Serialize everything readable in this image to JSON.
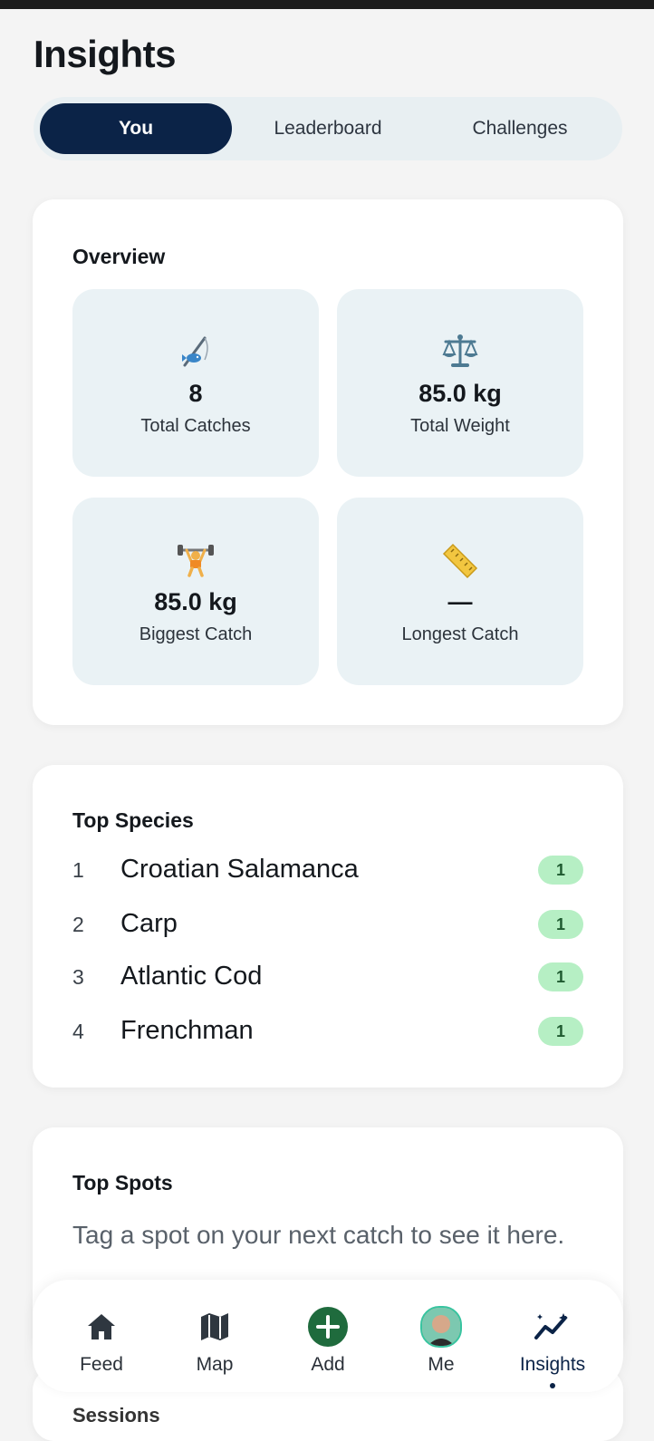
{
  "header": {
    "title": "Insights"
  },
  "tabs": [
    {
      "label": "You",
      "active": true
    },
    {
      "label": "Leaderboard",
      "active": false
    },
    {
      "label": "Challenges",
      "active": false
    }
  ],
  "overview": {
    "title": "Overview",
    "stats": [
      {
        "icon": "fishing-rod-icon",
        "value": "8",
        "label": "Total Catches"
      },
      {
        "icon": "scales-icon",
        "value": "85.0 kg",
        "label": "Total Weight"
      },
      {
        "icon": "weightlifter-icon",
        "value": "85.0 kg",
        "label": "Biggest Catch"
      },
      {
        "icon": "ruler-icon",
        "value": "—",
        "label": "Longest Catch"
      }
    ]
  },
  "top_species": {
    "title": "Top Species",
    "items": [
      {
        "rank": "1",
        "name": "Croatian Salamanca",
        "count": "1"
      },
      {
        "rank": "2",
        "name": "Carp",
        "count": "1"
      },
      {
        "rank": "3",
        "name": "Atlantic Cod",
        "count": "1"
      },
      {
        "rank": "4",
        "name": "Frenchman",
        "count": "1"
      }
    ]
  },
  "top_spots": {
    "title": "Top Spots",
    "empty_text": "Tag a spot on your next catch to see it here."
  },
  "next_section_peek": "Sessions",
  "bottom_nav": [
    {
      "label": "Feed",
      "icon": "home-icon"
    },
    {
      "label": "Map",
      "icon": "map-icon"
    },
    {
      "label": "Add",
      "icon": "add-icon"
    },
    {
      "label": "Me",
      "icon": "avatar"
    },
    {
      "label": "Insights",
      "icon": "insights-icon",
      "active": true
    }
  ],
  "colors": {
    "primary": "#0b2347",
    "accent_green": "#1f6b3d",
    "badge_bg": "#b6efc4",
    "stat_bg": "#eaf2f5",
    "page_bg": "#f4f4f4"
  }
}
